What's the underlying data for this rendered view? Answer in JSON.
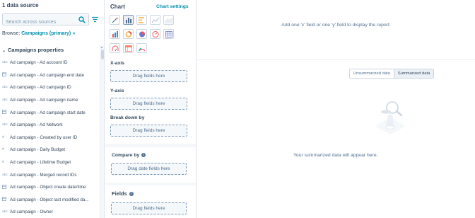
{
  "left_panel": {
    "title": "1 data source",
    "search_placeholder": "Search across sources",
    "browse_label": "Browse:",
    "browse_value": "Campaigns (primary)",
    "section_title": "Campaigns properties",
    "properties": [
      {
        "icon": "abc",
        "label": "Ad campaign - Ad account ID"
      },
      {
        "icon": "date",
        "label": "Ad campaign - Ad campaign end date"
      },
      {
        "icon": "abc",
        "label": "Ad campaign - Ad campaign ID"
      },
      {
        "icon": "abc",
        "label": "Ad campaign - Ad campaign name"
      },
      {
        "icon": "date",
        "label": "Ad campaign - Ad campaign start date"
      },
      {
        "icon": "abc",
        "label": "Ad campaign - Ad Network"
      },
      {
        "icon": "#",
        "label": "Ad campaign - Created by user ID"
      },
      {
        "icon": "#",
        "label": "Ad campaign - Daily Budget"
      },
      {
        "icon": "#",
        "label": "Ad campaign - Lifetime Budget"
      },
      {
        "icon": "abc",
        "label": "Ad campaign - Merged record IDs"
      },
      {
        "icon": "date",
        "label": "Ad campaign - Object create date/time"
      },
      {
        "icon": "date",
        "label": "Ad campaign - Object last modified da..."
      },
      {
        "icon": "abc",
        "label": "Ad campaign - Owner"
      }
    ]
  },
  "chart_panel": {
    "title": "Chart",
    "settings_link": "Chart settings",
    "x_axis_label": "X-axis",
    "x_axis_drop": "Drag fields here",
    "y_axis_label": "Y-axis",
    "y_axis_drop": "Drag fields here",
    "breakdown_label": "Break down by",
    "breakdown_drop": "Drag fields here",
    "compare_label": "Compare by",
    "compare_drop": "Drag date fields here",
    "fields_label": "Fields",
    "fields_drop": "Drag fields here",
    "chart_types": [
      "magic-wand-icon",
      "column-chart-icon",
      "bar-chart-icon",
      "line-chart-icon",
      "area-chart-icon",
      "stacked-column-icon",
      "donut-chart-icon",
      "pie-chart-icon",
      "gauge-icon",
      "table-icon",
      "kpi-icon",
      "pivot-table-icon",
      "combo-chart-icon"
    ],
    "selected_chart": "column-chart-icon"
  },
  "report_area": {
    "empty_message": "Add one 'x' field or one 'y' field to display the report.",
    "toggle_unsummarized": "Unsummarized data",
    "toggle_summarized": "Summarized data",
    "summary_message": "Your summarized data will appear here."
  },
  "colors": {
    "accent": "#0091ae",
    "text": "#33475b",
    "muted": "#516f90",
    "border": "#cbd6e2"
  }
}
